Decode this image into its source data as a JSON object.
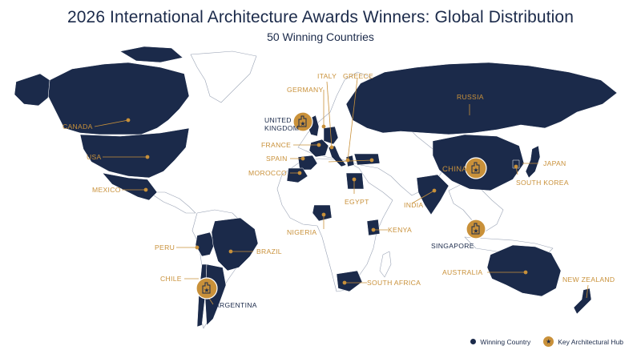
{
  "title": "2026 International Architecture Awards Winners: Global Distribution",
  "subtitle": "50 Winning Countries",
  "colors": {
    "winning": "#1b2a4a",
    "accent": "#c9913a",
    "land": "#ffffff",
    "border": "#9aa3b5"
  },
  "countries": {
    "canada": "CANADA",
    "usa": "USA",
    "mexico": "MEXICO",
    "peru": "PERU",
    "brazil": "BRAZIL",
    "chile": "CHILE",
    "argentina": "ARGENTINA",
    "united_kingdom_1": "UNITED",
    "united_kingdom_2": "KINGDOM",
    "germany": "GERMANY",
    "italy": "ITALY",
    "greece": "GREECE",
    "france": "FRANCE",
    "spain": "SPAIN",
    "morocco": "MOROCCO",
    "egypt": "EGYPT",
    "nigeria": "NIGERIA",
    "kenya": "KENYA",
    "south_africa": "SOUTH AFRICA",
    "russia": "RUSSIA",
    "india": "INDIA",
    "china": "CHINA",
    "japan": "JAPAN",
    "south_korea": "SOUTH KOREA",
    "singapore": "SINGAPORE",
    "australia": "AUSTRALIA",
    "new_zealand": "NEW ZEALAND"
  },
  "legend": {
    "winning": "Winning Country",
    "hub": "Key Architectural Hub"
  }
}
